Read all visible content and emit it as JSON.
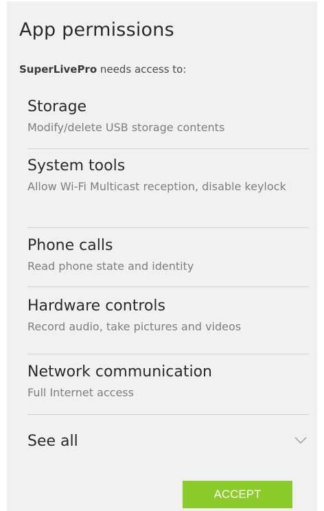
{
  "dialog": {
    "title": "App permissions",
    "intro_app": "SuperLivePro",
    "intro_text": " needs access to:",
    "permissions": [
      {
        "title": "Storage",
        "description": "Modify/delete USB storage contents"
      },
      {
        "title": "System tools",
        "description": "Allow Wi-Fi Multicast reception, disable keylock"
      },
      {
        "title": "Phone calls",
        "description": "Read phone state and identity"
      },
      {
        "title": "Hardware controls",
        "description": "Record audio, take pictures and videos"
      },
      {
        "title": "Network communication",
        "description": "Full Internet access"
      }
    ],
    "see_all_label": "See all",
    "see_all_icon": "chevron-down-icon",
    "accept_label": "ACCEPT",
    "accent_color": "#8ccc2a"
  }
}
